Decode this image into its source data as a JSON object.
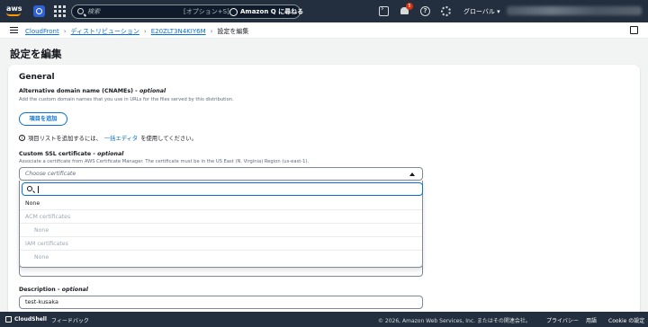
{
  "topnav": {
    "logo_text": "aws",
    "search_placeholder": "検索",
    "search_shortcut": "[オプション+S]",
    "amazon_q": "Amazon Q に尋ねる",
    "notification_count": "5",
    "help_glyph": "?",
    "region": "グローバル ▾"
  },
  "breadcrumb": {
    "items": [
      "CloudFront",
      "ディストリビューション",
      "E20ZLT3N4KIY6M",
      "設定を編集"
    ],
    "separator": "›"
  },
  "page": {
    "title": "設定を編集"
  },
  "general": {
    "heading": "General",
    "cname_label": "Alternative domain name (CNAMEs)",
    "cname_optional": "- optional",
    "cname_desc": "Add the custom domain names that you use in URLs for the files served by this distribution.",
    "add_item_button": "項目を追加",
    "info_prefix": "項目リストを追加するには、",
    "info_link": "一括エディタ",
    "info_suffix": "を使用してください。",
    "ssl_label": "Custom SSL certificate",
    "ssl_optional": "- optional",
    "ssl_desc": "Associate a certificate from AWS Certificate Manager. The certificate must be in the US East (N. Virginia) Region (us-east-1).",
    "ssl_placeholder": "Choose certificate",
    "dropdown": {
      "search_value": "",
      "options": [
        {
          "label": "None",
          "kind": "option"
        },
        {
          "label": "ACM certificates",
          "kind": "group"
        },
        {
          "label": "None",
          "kind": "disabled"
        },
        {
          "label": "IAM certificates",
          "kind": "group"
        },
        {
          "label": "None",
          "kind": "disabled"
        }
      ]
    },
    "description_label": "Description",
    "description_optional": "- optional",
    "description_value": "test-kusaka"
  },
  "footer": {
    "cloudshell": "CloudShell",
    "feedback": "フィードバック",
    "copyright": "© 2026, Amazon Web Services, Inc. またはその関連会社。",
    "privacy": "プライバシー",
    "terms": "用語",
    "cookie": "Cookie の設定"
  },
  "colors": {
    "nav_bg": "#232f3e",
    "link": "#0972d3",
    "accent_orange": "#ff9900",
    "badge_red": "#d13212"
  }
}
